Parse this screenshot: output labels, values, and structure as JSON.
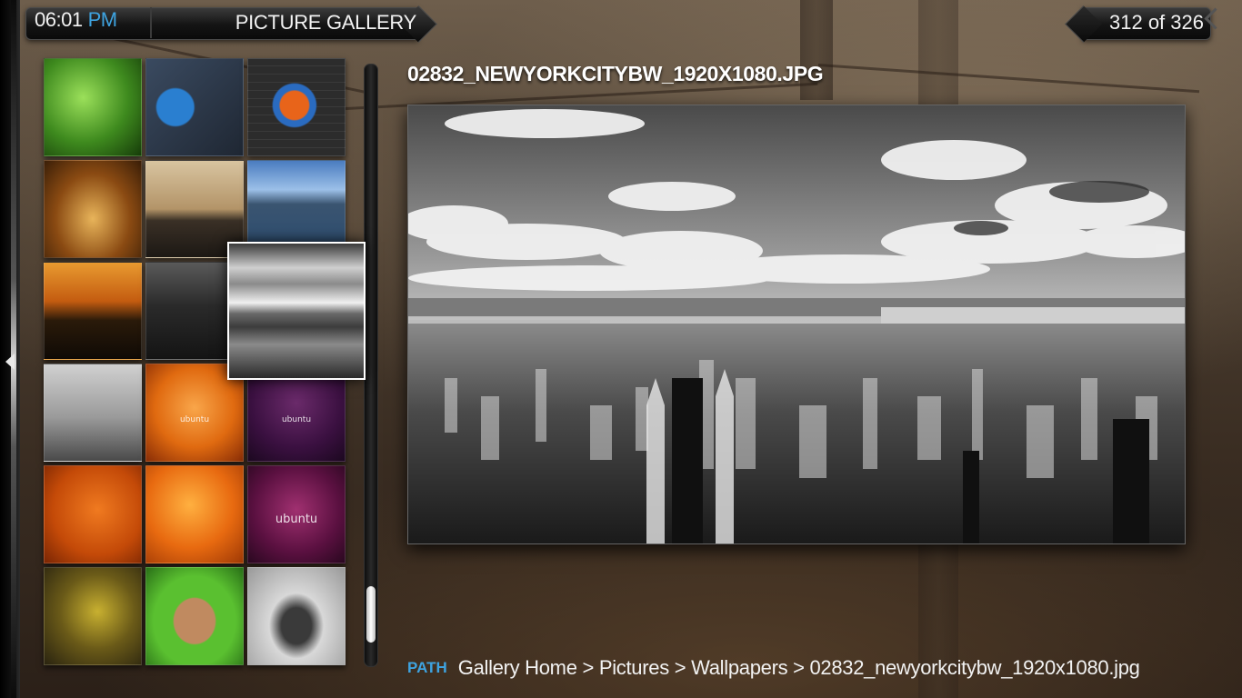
{
  "header": {
    "time": "06:01",
    "ampm": "PM",
    "section_title": "PICTURE GALLERY",
    "position_counter": "312 of 326"
  },
  "thumbnails": [
    {
      "name": "thumb-nvidia-green",
      "caption": ""
    },
    {
      "name": "thumb-firefox-graffiti",
      "caption": ""
    },
    {
      "name": "thumb-firefox-bricks",
      "caption": ""
    },
    {
      "name": "thumb-autumn-road",
      "caption": ""
    },
    {
      "name": "thumb-beige-lake",
      "caption": ""
    },
    {
      "name": "thumb-blue-lake",
      "caption": ""
    },
    {
      "name": "thumb-sunset-beach",
      "caption": ""
    },
    {
      "name": "thumb-dark-city",
      "caption": ""
    },
    {
      "name": "thumb-newyork-bw",
      "caption": ""
    },
    {
      "name": "thumb-bridge-bw",
      "caption": ""
    },
    {
      "name": "thumb-ubuntu-orange",
      "caption": "ubuntu"
    },
    {
      "name": "thumb-ubuntu-purple",
      "caption": "ubuntu"
    },
    {
      "name": "thumb-orange-1",
      "caption": ""
    },
    {
      "name": "thumb-orange-2",
      "caption": ""
    },
    {
      "name": "thumb-ubuntu-plum",
      "caption": "ubuntu"
    },
    {
      "name": "thumb-rainy-person",
      "caption": ""
    },
    {
      "name": "thumb-green-hood-woman",
      "caption": ""
    },
    {
      "name": "thumb-muscle-car",
      "caption": ""
    }
  ],
  "preview": {
    "filename": "02832_NEWYORKCITYBW_1920X1080.JPG"
  },
  "path": {
    "label": "PATH",
    "value": "Gallery Home > Pictures > Wallpapers > 02832_newyorkcitybw_1920x1080.jpg"
  },
  "colors": {
    "accent_blue": "#3ea3e0",
    "text_white": "#f2f2f2"
  },
  "scroll": {
    "position_fraction": 0.96
  }
}
